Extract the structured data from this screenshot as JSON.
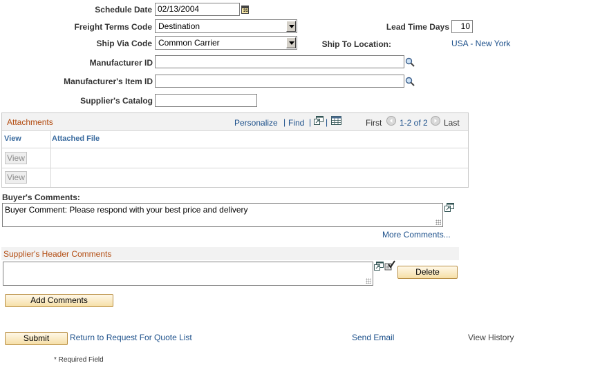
{
  "form": {
    "schedule_date": {
      "label": "Schedule Date",
      "value": "02/13/2004"
    },
    "freight_terms": {
      "label": "Freight Terms Code",
      "value": "Destination"
    },
    "ship_via": {
      "label": "Ship Via Code",
      "value": "Common Carrier"
    },
    "lead_time": {
      "label": "Lead Time Days",
      "value": "10"
    },
    "ship_to": {
      "label": "Ship To Location:",
      "value": "USA - New York"
    },
    "manufacturer_id": {
      "label": "Manufacturer ID",
      "value": ""
    },
    "manufacturer_item_id": {
      "label": "Manufacturer's Item ID",
      "value": ""
    },
    "supplier_catalog": {
      "label": "Supplier's Catalog",
      "value": ""
    }
  },
  "attachments": {
    "title": "Attachments",
    "personalize": "Personalize",
    "find": "Find",
    "first": "First",
    "range": "1-2 of 2",
    "last": "Last",
    "col_view": "View",
    "col_file": "Attached File",
    "rows": [
      {
        "view": "View",
        "file": ""
      },
      {
        "view": "View",
        "file": ""
      }
    ]
  },
  "buyer": {
    "label": "Buyer's Comments:",
    "comment": "Buyer Comment: Please respond with your best price and delivery",
    "more": "More Comments..."
  },
  "supplier": {
    "title": "Supplier's Header Comments",
    "comment": "",
    "delete": "Delete",
    "add": "Add Comments"
  },
  "footer": {
    "submit": "Submit",
    "return_link": "Return to Request For Quote List",
    "send_email": "Send Email",
    "view_history": "View History",
    "required": "* Required Field"
  },
  "colors": {
    "link": "#1b4f8a",
    "section_title": "#b34d12",
    "button_border": "#b88e43"
  }
}
